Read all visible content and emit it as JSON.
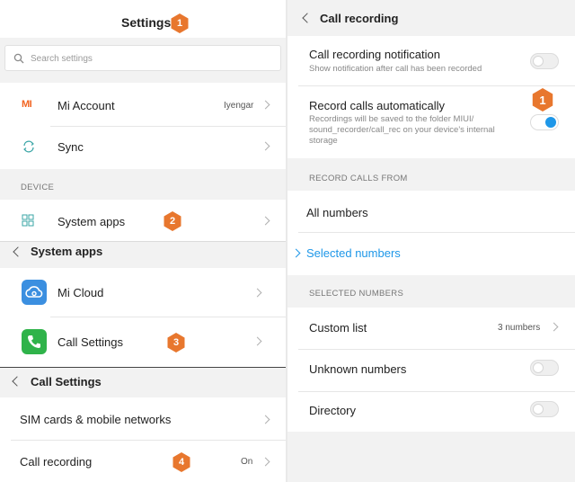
{
  "settings": {
    "title": "Settings",
    "search_placeholder": "Search settings",
    "mi_account": {
      "label": "Mi Account",
      "value": "Iyengar",
      "icon": "mi-logo-icon"
    },
    "sync": {
      "label": "Sync",
      "icon": "sync-icon"
    },
    "device_section": "DEVICE",
    "system_apps": {
      "label": "System apps",
      "icon": "grid-icon"
    }
  },
  "system_apps_screen": {
    "title": "System apps",
    "mi_cloud": {
      "label": "Mi Cloud",
      "icon": "cloud-icon"
    },
    "call_settings": {
      "label": "Call Settings",
      "icon": "phone-icon"
    }
  },
  "call_settings_screen": {
    "title": "Call Settings",
    "sim_cards": {
      "label": "SIM cards & mobile networks"
    },
    "call_recording": {
      "label": "Call recording",
      "value": "On"
    }
  },
  "call_recording_screen": {
    "title": "Call recording",
    "notification": {
      "label": "Call recording notification",
      "sub": "Show notification after call has been recorded",
      "enabled": false
    },
    "auto_record": {
      "label": "Record calls automatically",
      "sub_line1": "Recordings will be saved to the folder MIUI/",
      "sub_line2": "sound_recorder/call_rec on your device's internal",
      "sub_line3": "storage",
      "enabled": true
    },
    "record_from_section": "RECORD CALLS FROM",
    "all_numbers": "All numbers",
    "selected_numbers": "Selected numbers",
    "selected_section": "SELECTED NUMBERS",
    "custom_list": {
      "label": "Custom list",
      "value": "3 numbers"
    },
    "unknown_numbers": {
      "label": "Unknown numbers",
      "enabled": false
    },
    "directory": {
      "label": "Directory",
      "enabled": false
    }
  },
  "badges": [
    "1",
    "2",
    "3",
    "4",
    "1"
  ],
  "colors": {
    "accent_blue": "#1e97e8",
    "badge_orange": "#e8772e",
    "mi_orange": "#f26522",
    "cloud_blue": "#3b8fe0",
    "phone_green": "#2fb34a"
  }
}
